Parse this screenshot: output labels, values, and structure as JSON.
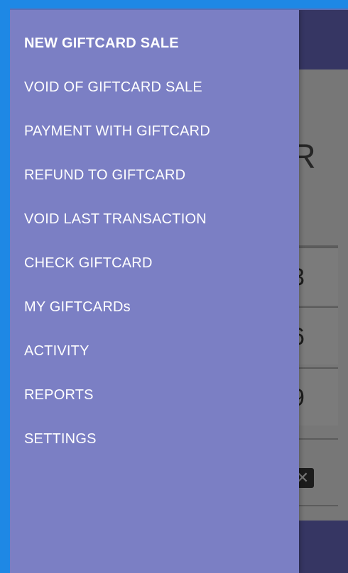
{
  "drawer": {
    "items": [
      {
        "label": "NEW GIFTCARD SALE",
        "active": true
      },
      {
        "label": "VOID OF GIFTCARD SALE",
        "active": false
      },
      {
        "label": "PAYMENT WITH GIFTCARD",
        "active": false
      },
      {
        "label": "REFUND TO GIFTCARD",
        "active": false
      },
      {
        "label": "VOID LAST TRANSACTION",
        "active": false
      },
      {
        "label": "CHECK GIFTCARD",
        "active": false
      },
      {
        "label": "MY GIFTCARDs",
        "active": false
      },
      {
        "label": "ACTIVITY",
        "active": false
      },
      {
        "label": "REPORTS",
        "active": false
      },
      {
        "label": "SETTINGS",
        "active": false
      }
    ]
  },
  "background_app": {
    "partial_label": "R",
    "key_digits": [
      "3",
      "6",
      "9"
    ],
    "clear_key_glyph": "✕"
  },
  "colors": {
    "drawer_bg": "#7b7fc4",
    "toolbar_bg": "#363663",
    "scrim_bg": "#777777",
    "frame_blue": "#1e88e5"
  }
}
